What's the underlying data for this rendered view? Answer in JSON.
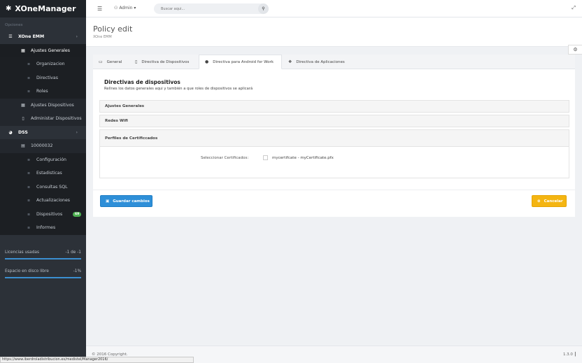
{
  "app": {
    "brand": "XOneManager"
  },
  "sidebar": {
    "section_label": "Opciones",
    "items": [
      {
        "label": "XOne EMM",
        "icon": "list-icon"
      },
      {
        "label": "Ajustes Generales",
        "icon": "table-icon"
      },
      {
        "label": "Organizacion",
        "icon": "building-icon"
      },
      {
        "label": "Directivas",
        "icon": "lock-icon"
      },
      {
        "label": "Roles",
        "icon": "user-icon"
      },
      {
        "label": "Ajustes Dispositivos",
        "icon": "table-icon"
      },
      {
        "label": "Administar Dispositivos",
        "icon": "mobile-icon"
      },
      {
        "label": "DSS",
        "icon": "dashboard-icon"
      },
      {
        "label": "10000032",
        "icon": "document-icon"
      },
      {
        "label": "Configuración",
        "icon": "wrench-icon"
      },
      {
        "label": "Estadisticas",
        "icon": "chart-icon"
      },
      {
        "label": "Consultas SQL",
        "icon": "database-icon"
      },
      {
        "label": "Actualizaciones",
        "icon": "refresh-icon"
      },
      {
        "label": "Dispositivos",
        "icon": "mobile-icon",
        "badge": "69"
      },
      {
        "label": "Informes",
        "icon": "report-icon"
      }
    ],
    "stats": [
      {
        "label": "Licencias usadas",
        "value": "-1 de -1",
        "fill": 1.0
      },
      {
        "label": "Espacio en disco libre",
        "value": "-1%",
        "fill": 1.0
      }
    ]
  },
  "topbar": {
    "user": "Admin",
    "search_placeholder": "Buscar aqui..."
  },
  "header": {
    "title": "Policy edit",
    "subtitle": "XOne EMM"
  },
  "tabs": [
    {
      "label": "General",
      "icon": "folder-icon"
    },
    {
      "label": "Directiva de Dispositivos",
      "icon": "mobile-icon"
    },
    {
      "label": "Directiva para Android for Work",
      "icon": "android-icon",
      "active": true
    },
    {
      "label": "Directiva de Aplicaciones",
      "icon": "apps-icon"
    }
  ],
  "content": {
    "title": "Directivas de dispositivos",
    "description": "Rellnes los datos generales aqui y también a que roles de dispositivos se aplicará",
    "sections": [
      "Ajustes Generales",
      "Redes Wifi",
      "Perfiles de Certificcados"
    ],
    "cert_label": "Seleccionar Certificados:",
    "cert_option": "mycertifcate - myCertificate.pfx",
    "cert_checked": false
  },
  "buttons": {
    "save": "Guardar cambios",
    "cancel": "Cancelar"
  },
  "footer": {
    "copyright": "© 2016 Copyright.",
    "version": "1.3.0",
    "status_url": "https://www.iberdroladistribucion.es/medistel/Manager2016/"
  }
}
